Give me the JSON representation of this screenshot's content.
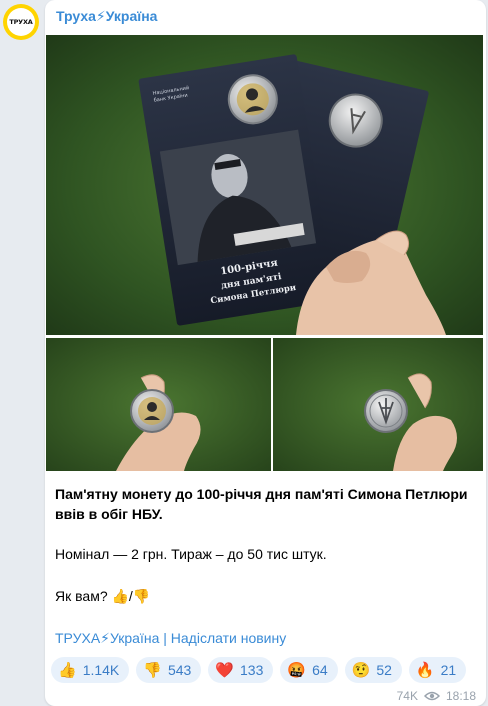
{
  "avatar": {
    "text": "ТРУХА",
    "ring_color": "#ffd400"
  },
  "channel": {
    "name": "Труха⚡Україна"
  },
  "photo": {
    "card_brand_line1": "Національний",
    "card_brand_line2": "банк України",
    "card_title_line1": "100-річчя",
    "card_title_line2": "дня пам'яті",
    "card_title_line3": "Симона Петлюри"
  },
  "caption": {
    "headline": "Пам'ятну монету до 100-річчя дня пам'яті Симона Петлюри ввів в обіг НБУ.",
    "details": "Номінал — 2 грн. Тираж – до 50 тис штук.",
    "question": "Як вам? 👍/👎"
  },
  "footer_link": "ТРУХА⚡Україна | Надіслати новину",
  "reactions": [
    {
      "emoji": "👍",
      "count": "1.14K"
    },
    {
      "emoji": "👎",
      "count": "543"
    },
    {
      "emoji": "❤️",
      "count": "133"
    },
    {
      "emoji": "🤬",
      "count": "64"
    },
    {
      "emoji": "🤨",
      "count": "52"
    },
    {
      "emoji": "🔥",
      "count": "21"
    }
  ],
  "meta": {
    "views": "74K",
    "time": "18:18"
  },
  "colors": {
    "link": "#3a8bd6",
    "reaction_bg": "#e8f1fb",
    "background": "#e7ebf0"
  }
}
